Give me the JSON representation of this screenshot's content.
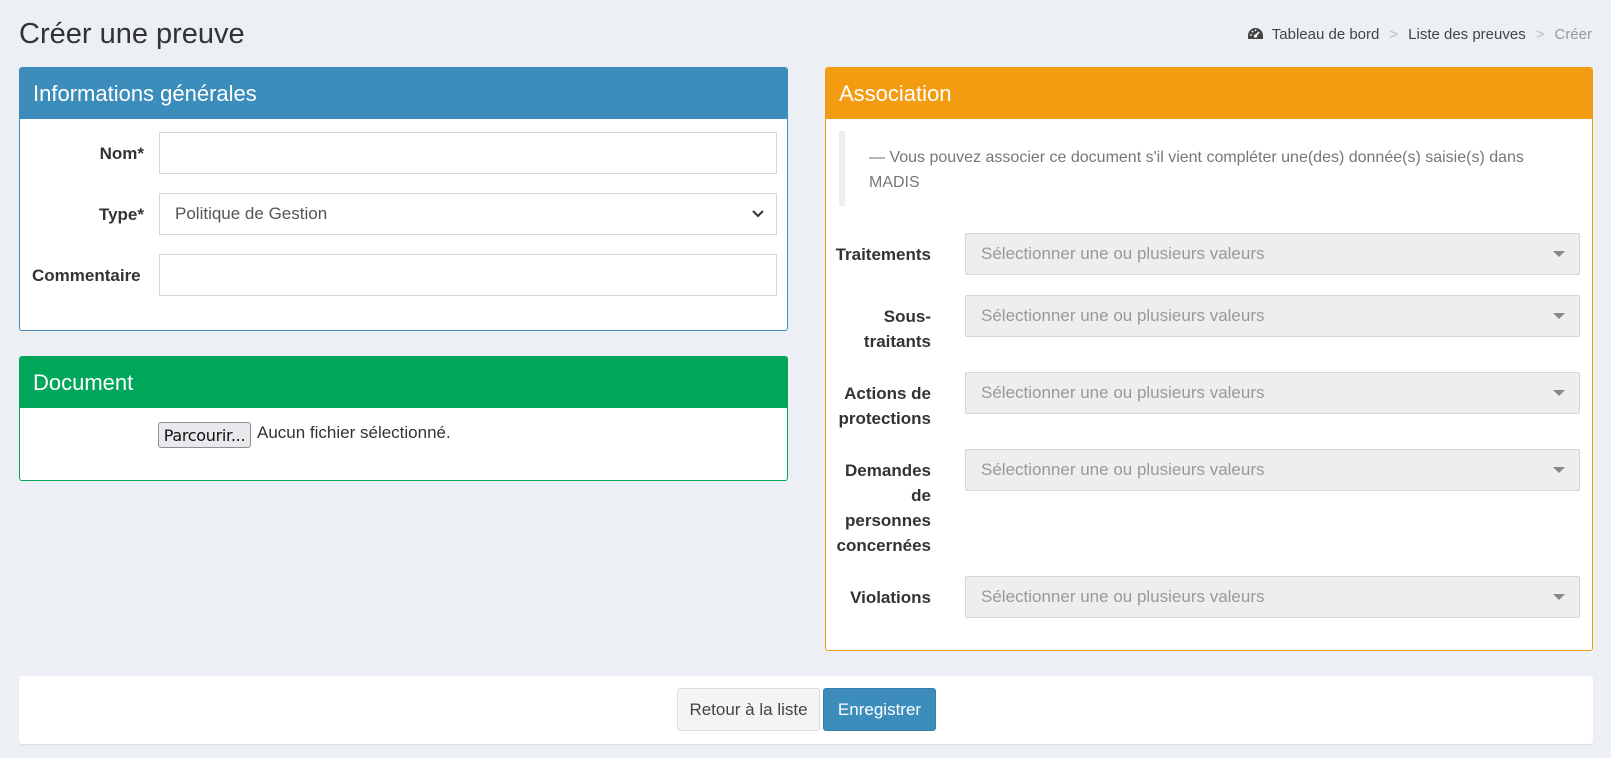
{
  "page": {
    "title": "Créer une preuve"
  },
  "breadcrumb": {
    "items": [
      "Tableau de bord",
      "Liste des preuves",
      "Créer"
    ],
    "separator": ">",
    "icon": "dashboard-icon"
  },
  "general": {
    "title": "Informations générales",
    "name_label": "Nom*",
    "name_value": "",
    "type_label": "Type*",
    "type_value": "Politique de Gestion",
    "comment_label": "Commentaire",
    "comment_value": ""
  },
  "document": {
    "title": "Document",
    "browse_label": "Parcourir...",
    "file_status": "Aucun fichier sélectionné."
  },
  "association": {
    "title": "Association",
    "note": "— Vous pouvez associer ce document s'il vient compléter une(des) donnée(s) saisie(s) dans MADIS",
    "placeholder": "Sélectionner une ou plusieurs valeurs",
    "fields": [
      {
        "label": "Traitements"
      },
      {
        "label": "Sous-traitants"
      },
      {
        "label": "Actions de protections"
      },
      {
        "label": "Demandes de personnes concernées"
      },
      {
        "label": "Violations"
      }
    ]
  },
  "footer": {
    "back_label": "Retour à la liste",
    "save_label": "Enregistrer"
  },
  "colors": {
    "blue": "#3c8dbc",
    "green": "#00a65a",
    "orange": "#f39c12",
    "background": "#ecf0f5"
  }
}
